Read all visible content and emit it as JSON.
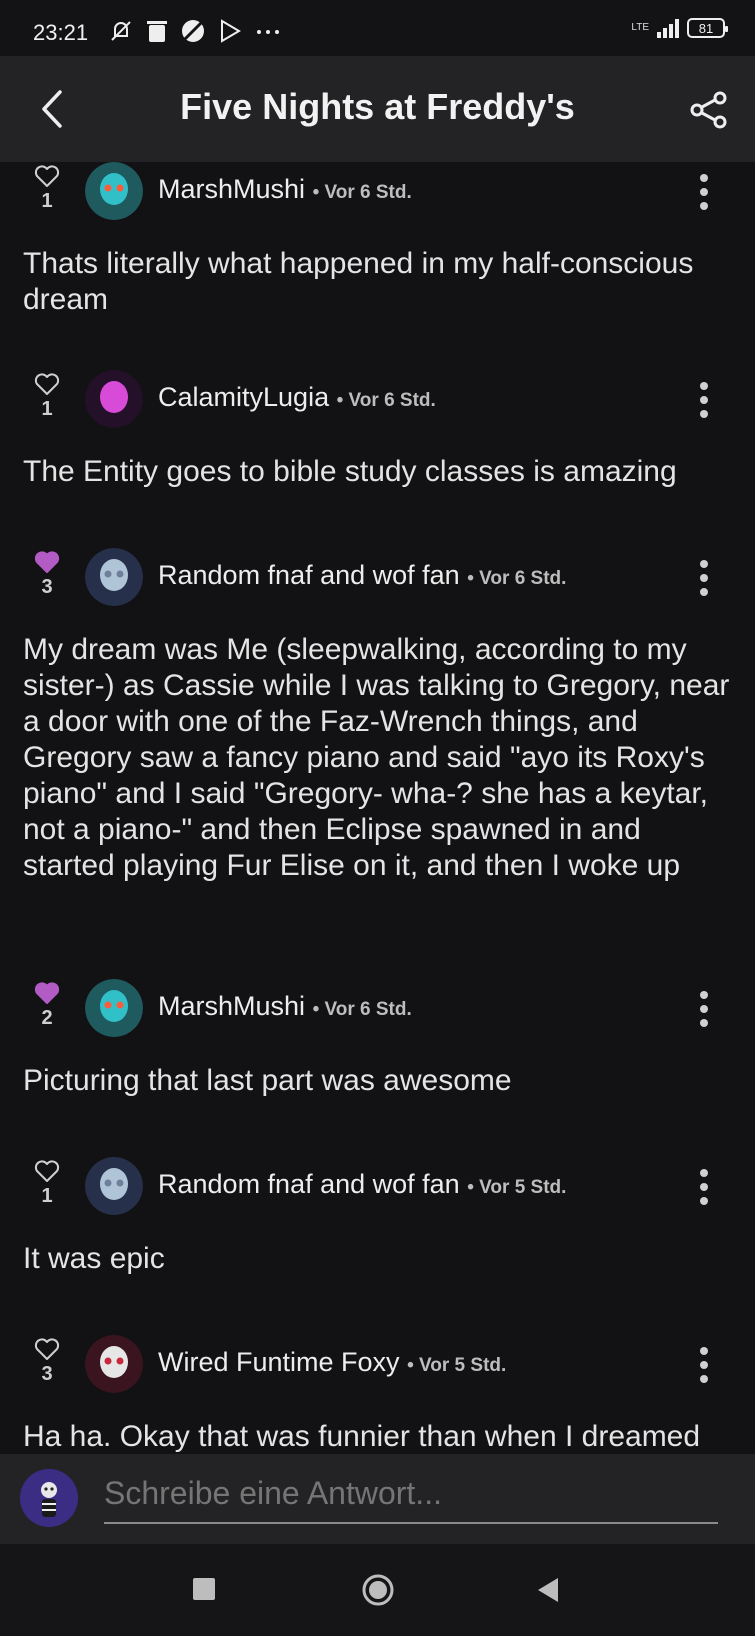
{
  "status_bar": {
    "time": "23:21",
    "network": "LTE",
    "battery": "81"
  },
  "header": {
    "title": "Five Nights at Freddy's"
  },
  "comments": [
    {
      "likes": "1",
      "liked": false,
      "author": "MarshMushi",
      "time": "• Vor 6 Std.",
      "text": "Thats literally what happened in my half-conscious dream"
    },
    {
      "likes": "1",
      "liked": false,
      "author": "CalamityLugia",
      "time": "• Vor 6 Std.",
      "text": "The Entity goes to bible study classes is amazing"
    },
    {
      "likes": "3",
      "liked": true,
      "author": "Random fnaf and wof fan",
      "time": "• Vor 6 Std.",
      "text": "My dream was Me (sleepwalking, according to my sister-) as Cassie while I was talking to Gregory, near a door with one of the Faz-Wrench things, and Gregory saw a fancy piano and said \"ayo its Roxy's piano\" and I said \"Gregory- wha-? she has a keytar, not a piano-\" and then Eclipse spawned in and started playing Fur Elise on it, and then I woke up"
    },
    {
      "likes": "2",
      "liked": true,
      "author": "MarshMushi",
      "time": "• Vor 6 Std.",
      "text": "Picturing that last part was awesome"
    },
    {
      "likes": "1",
      "liked": false,
      "author": "Random fnaf and wof fan",
      "time": "• Vor 5 Std.",
      "text": "It was epic"
    },
    {
      "likes": "3",
      "liked": false,
      "author": "Wired Funtime Foxy",
      "time": "• Vor 5 Std.",
      "text": "Ha ha. Okay that was funnier than when I dreamed"
    }
  ],
  "reply": {
    "placeholder": "Schreibe eine Antwort..."
  },
  "colors": {
    "liked_heart": "#b25bc4",
    "background": "#121214",
    "bar": "#232325"
  }
}
